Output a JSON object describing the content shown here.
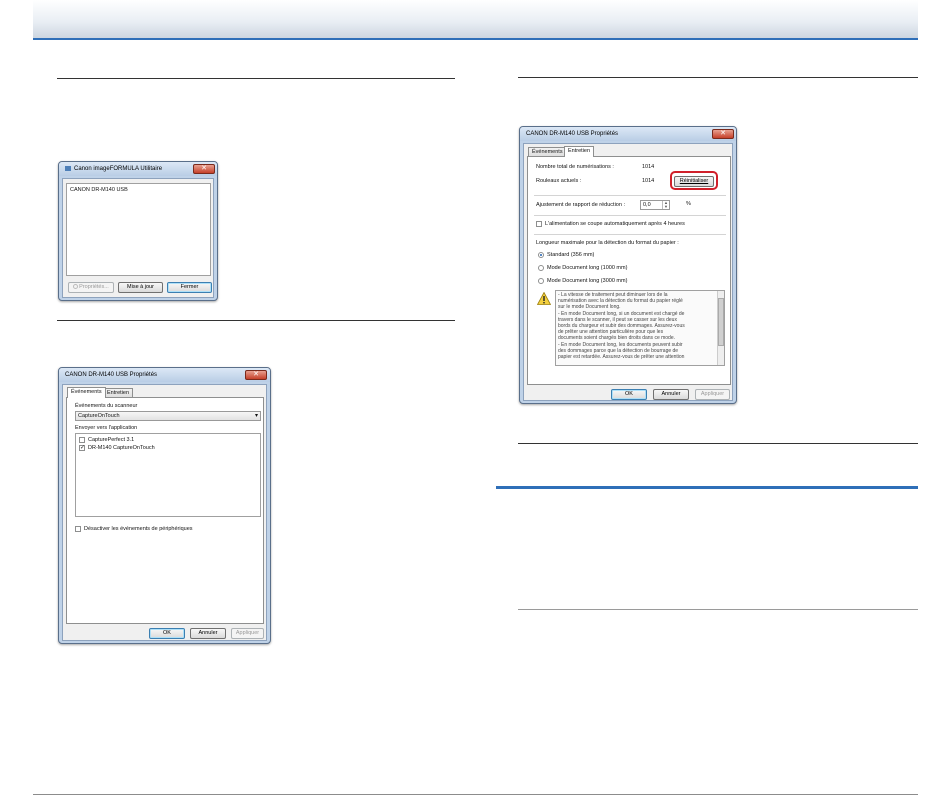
{
  "utility_window": {
    "title": "Canon imageFORMULA Utilitaire",
    "device_item": "CANON DR-M140 USB",
    "btn_properties": "Propriétés...",
    "btn_update": "Mise à jour",
    "btn_close": "Fermer"
  },
  "events_window": {
    "title": "CANON DR-M140 USB Propriétés",
    "tab_events": "Événements",
    "tab_maintenance": "Entretien",
    "scanner_events_label": "Événements du scanneur",
    "scanner_events_value": "CaptureOnTouch",
    "send_to_label": "Envoyer vers l'application",
    "apps": [
      {
        "label": "CapturePerfect 3.1",
        "checked": false
      },
      {
        "label": "DR-M140 CaptureOnTouch",
        "checked": true
      }
    ],
    "disable_events_label": "Désactiver les événements de périphériques",
    "btn_ok": "OK",
    "btn_cancel": "Annuler",
    "btn_apply": "Appliquer"
  },
  "maintenance_window": {
    "title": "CANON DR-M140 USB Propriétés",
    "tab_events": "Événements",
    "tab_maintenance": "Entretien",
    "total_scans_label": "Nombre total de numérisations :",
    "total_scans_value": "1014",
    "rollers_label": "Rouleaux actuels :",
    "rollers_value": "1014",
    "reset_button": "Réinitialiser",
    "reduction_label": "Ajustement de rapport de réduction :",
    "reduction_value": "0,0",
    "reduction_unit": "%",
    "auto_off_label": "L'alimentation se coupe automatiquement après 4 heures",
    "max_length_label": "Longueur maximale pour la détection du format du papier :",
    "length_options": [
      {
        "label": "Standard (356 mm)",
        "selected": true
      },
      {
        "label": "Mode Document long (1000 mm)",
        "selected": false
      },
      {
        "label": "Mode Document long (3000 mm)",
        "selected": false
      }
    ],
    "warning_lines": [
      "- La vitesse de traitement peut diminuer lors de la",
      "numérisation avec la détection du format du papier réglé",
      "sur le mode Document long.",
      "- En mode Document long, si un document est chargé de",
      "travers dans le scanner, il peut se casser sur les deux",
      "bords du chargeur et subir des dommages. Assurez-vous",
      "de prêter une attention particulière pour que les",
      "documents soient chargés bien droits dans ce mode.",
      "- En mode Document long, les documents peuvent subir",
      "des dommages parce que la détection de bourrage de",
      "papier est retardée. Assurez-vous de prêter une attention"
    ],
    "btn_ok": "OK",
    "btn_cancel": "Annuler",
    "btn_apply": "Appliquer"
  },
  "colors": {
    "accent_blue": "#2f6fb8",
    "highlight_red": "#d0202a"
  }
}
